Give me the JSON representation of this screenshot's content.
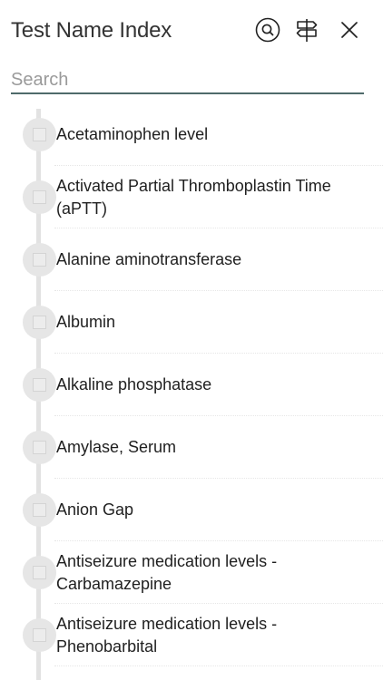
{
  "header": {
    "title": "Test Name Index",
    "icons": [
      "search-circle-icon",
      "signpost-icon",
      "close-icon"
    ]
  },
  "search": {
    "placeholder": "Search",
    "value": ""
  },
  "items": [
    {
      "label": "Acetaminophen level",
      "checked": false
    },
    {
      "label": "Activated Partial Thromboplastin Time (aPTT)",
      "checked": false
    },
    {
      "label": "Alanine aminotransferase",
      "checked": false
    },
    {
      "label": "Albumin",
      "checked": false
    },
    {
      "label": "Alkaline phosphatase",
      "checked": false
    },
    {
      "label": "Amylase, Serum",
      "checked": false
    },
    {
      "label": "Anion Gap",
      "checked": false
    },
    {
      "label": "Antiseizure medication levels - Carbamazepine",
      "checked": false
    },
    {
      "label": "Antiseizure medication levels - Phenobarbital",
      "checked": false
    }
  ],
  "colors": {
    "accent_underline": "#4f6a6a",
    "timeline": "#e2e2e2",
    "text": "#1f1f1f"
  }
}
